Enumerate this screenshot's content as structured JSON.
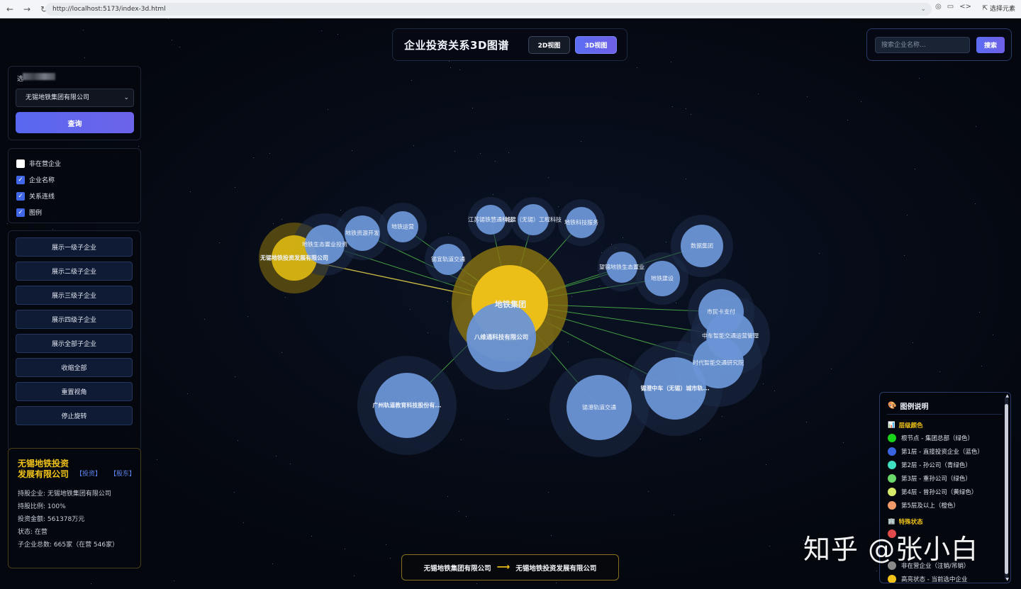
{
  "browser": {
    "url": "http://localhost:5173/index-3d.html",
    "select_element_label": "选择元素"
  },
  "header": {
    "title": "企业投资关系3D图谱",
    "view_2d": "2D视图",
    "view_3d": "3D视图"
  },
  "search": {
    "placeholder": "搜索企业名称...",
    "button": "搜索"
  },
  "query": {
    "label": "选",
    "selected_company": "无锡地铁集团有限公司",
    "button": "查询"
  },
  "options": [
    {
      "label": "非在营企业",
      "checked": false
    },
    {
      "label": "企业名称",
      "checked": true
    },
    {
      "label": "关系连线",
      "checked": true
    },
    {
      "label": "图例",
      "checked": true
    }
  ],
  "actions": [
    "展示一级子企业",
    "展示二级子企业",
    "展示三级子企业",
    "展示四级子企业",
    "展示全部子企业",
    "收缩全部",
    "重置视角",
    "停止旋转"
  ],
  "info": {
    "name": "无锡地铁投资发展有限公司",
    "link_invest": "【投资】",
    "link_holder": "【股东】",
    "lines": [
      "持股企业: 无锡地铁集团有限公司",
      "持股比例: 100%",
      "投资金额: 561378万元",
      "状态: 在营",
      "子企业总数: 665家（在营 546家）"
    ]
  },
  "graph": {
    "root": {
      "label": "地铁集团",
      "color": "#f2c318"
    },
    "nodes": [
      {
        "id": "n1",
        "label": "无锡地铁投资发展有限公司",
        "highlight": true
      },
      {
        "id": "n2",
        "label": "地铁生态置业投资"
      },
      {
        "id": "n3",
        "label": "地铁资源开发"
      },
      {
        "id": "n4",
        "label": "地铁运营"
      },
      {
        "id": "n5",
        "label": "锡宜轨道交通"
      },
      {
        "id": "n6",
        "label": "江苏锡铁慧通科技"
      },
      {
        "id": "n7",
        "label": "城建（无锡）工程科技"
      },
      {
        "id": "n8",
        "label": "地铁科技服务"
      },
      {
        "id": "n9",
        "label": "望锦地铁生态置业"
      },
      {
        "id": "n10",
        "label": "地铁建设"
      },
      {
        "id": "n11",
        "label": "数据集团"
      },
      {
        "id": "n12",
        "label": "市民卡支付"
      },
      {
        "id": "n13",
        "label": "中车智能交通运营管理"
      },
      {
        "id": "n14",
        "label": "时代智能交通研究院"
      },
      {
        "id": "n15",
        "label": "锡澄中车（无锡）城市轨...",
        "highlight": true
      },
      {
        "id": "n16",
        "label": "锡澄轨道交通"
      },
      {
        "id": "n17",
        "label": "八维通科技有限公司",
        "highlight": true
      },
      {
        "id": "n18",
        "label": "广州轨道教育科技股份有...",
        "highlight": true
      }
    ],
    "colors": {
      "node": "#6a95d6",
      "halo": "#1d2c48",
      "edge": "#4fb84a",
      "edge_highlight": "#e8d44a",
      "label_highlight": "#f2c318"
    }
  },
  "legend": {
    "title": "图例说明",
    "section_levels": "层级颜色",
    "levels": [
      {
        "label": "根节点 - 集团总部（绿色）",
        "color": "#19d21a"
      },
      {
        "label": "第1层 - 直接投资企业（蓝色）",
        "color": "#3a63e0"
      },
      {
        "label": "第2层 - 孙公司（青绿色）",
        "color": "#3ee0c2"
      },
      {
        "label": "第3层 - 重孙公司（绿色）",
        "color": "#6ad86a"
      },
      {
        "label": "第4层 - 曾孙公司（黄绿色）",
        "color": "#d6ea6a"
      },
      {
        "label": "第5层及以上（橙色）",
        "color": "#f09a6a"
      }
    ],
    "section_special": "特殊状态",
    "special": [
      {
        "label": "",
        "color": "#e04a4a"
      },
      {
        "label": "非在营企业（注销/吊销）",
        "color": "#8a8a8a"
      },
      {
        "label": "高亮状态 - 当前选中企业",
        "color": "#f2c318"
      }
    ]
  },
  "path": {
    "from": "无锡地铁集团有限公司",
    "arrow": "⟶",
    "to": "无锡地铁投资发展有限公司"
  },
  "watermark": "知乎 @张小白"
}
